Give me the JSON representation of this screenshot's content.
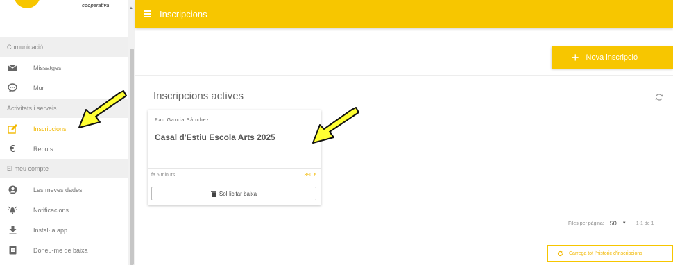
{
  "brand": {
    "name": "cooperativa"
  },
  "sidebar": {
    "sections": [
      {
        "label": "Comunicació"
      },
      {
        "label": "Activitats i serveis"
      },
      {
        "label": "El meu compte"
      }
    ],
    "items": [
      {
        "label": "Missatges",
        "icon": "mail-icon"
      },
      {
        "label": "Mur",
        "icon": "chat-bubble-icon"
      },
      {
        "label": "Inscripcions",
        "icon": "edit-icon",
        "active": true
      },
      {
        "label": "Rebuts",
        "icon": "euro-icon"
      },
      {
        "label": "Les meves dades",
        "icon": "account-icon"
      },
      {
        "label": "Notificacions",
        "icon": "notification-icon"
      },
      {
        "label": "Instal·la app",
        "icon": "download-icon"
      },
      {
        "label": "Doneu-me de baixa",
        "icon": "exit-icon"
      }
    ]
  },
  "header": {
    "title": "Inscripcions"
  },
  "actions": {
    "new_label": "Nova inscripció"
  },
  "main": {
    "section_title": "Inscripcions actives"
  },
  "card": {
    "person": "Pau Garcia Sánchez",
    "title": "Casal d'Estiu Escola Arts 2025",
    "time": "fa 5 minuts",
    "price": "390 €",
    "cancel_label": "Sol·licitar baixa"
  },
  "pagination": {
    "rows_label": "Files per pàgina:",
    "per_page": "50",
    "range": "1-1 de 1"
  },
  "history": {
    "label": "Carrega tot l'historic d'inscripcions"
  },
  "colors": {
    "accent": "#f7c600",
    "annotation_arrow": "#ffff33"
  }
}
